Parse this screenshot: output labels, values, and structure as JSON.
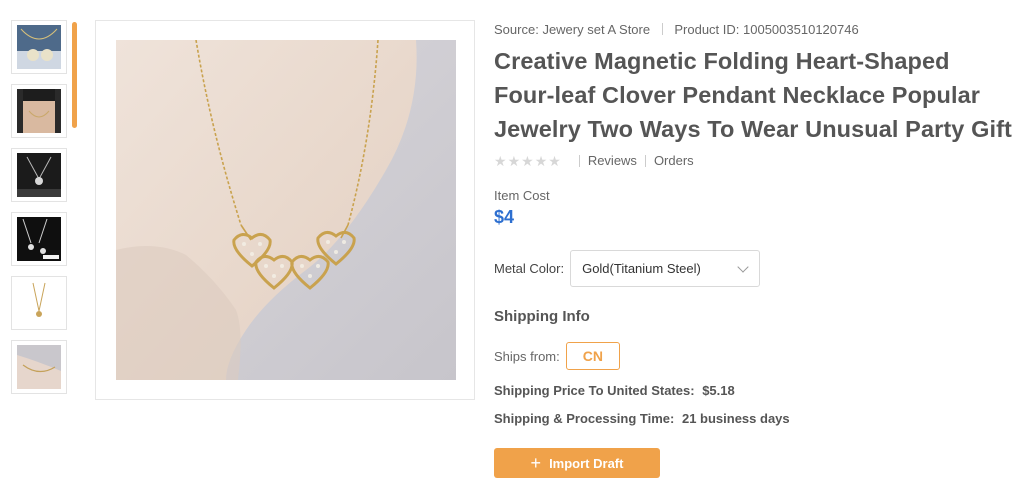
{
  "thumbnails": [
    {
      "alt": "thumb-1"
    },
    {
      "alt": "thumb-2"
    },
    {
      "alt": "thumb-3"
    },
    {
      "alt": "thumb-4"
    },
    {
      "alt": "thumb-5"
    },
    {
      "alt": "thumb-6"
    }
  ],
  "product": {
    "source_label": "Source:",
    "source_value": "Jewery set A Store",
    "id_label": "Product ID:",
    "id_value": "1005003510120746",
    "title": "Creative Magnetic Folding Heart-Shaped Four-leaf Clover Pendant Necklace Popular Jewelry Two Ways To Wear Unusual Party Gift",
    "rating_value": 0,
    "reviews_label": "Reviews",
    "orders_label": "Orders",
    "cost_label": "Item Cost",
    "cost_value": "$4",
    "color_label": "Metal Color:",
    "color_selected": "Gold(Titanium Steel)"
  },
  "shipping": {
    "heading": "Shipping Info",
    "ships_from_label": "Ships from:",
    "ships_from_value": "CN",
    "price_label": "Shipping Price To United States:",
    "price_value": "$5.18",
    "time_label": "Shipping & Processing Time:",
    "time_value": "21 business days"
  },
  "actions": {
    "import_label": "Import Draft"
  },
  "colors": {
    "accent": "#f0a24a",
    "price": "#2d6fd0"
  }
}
